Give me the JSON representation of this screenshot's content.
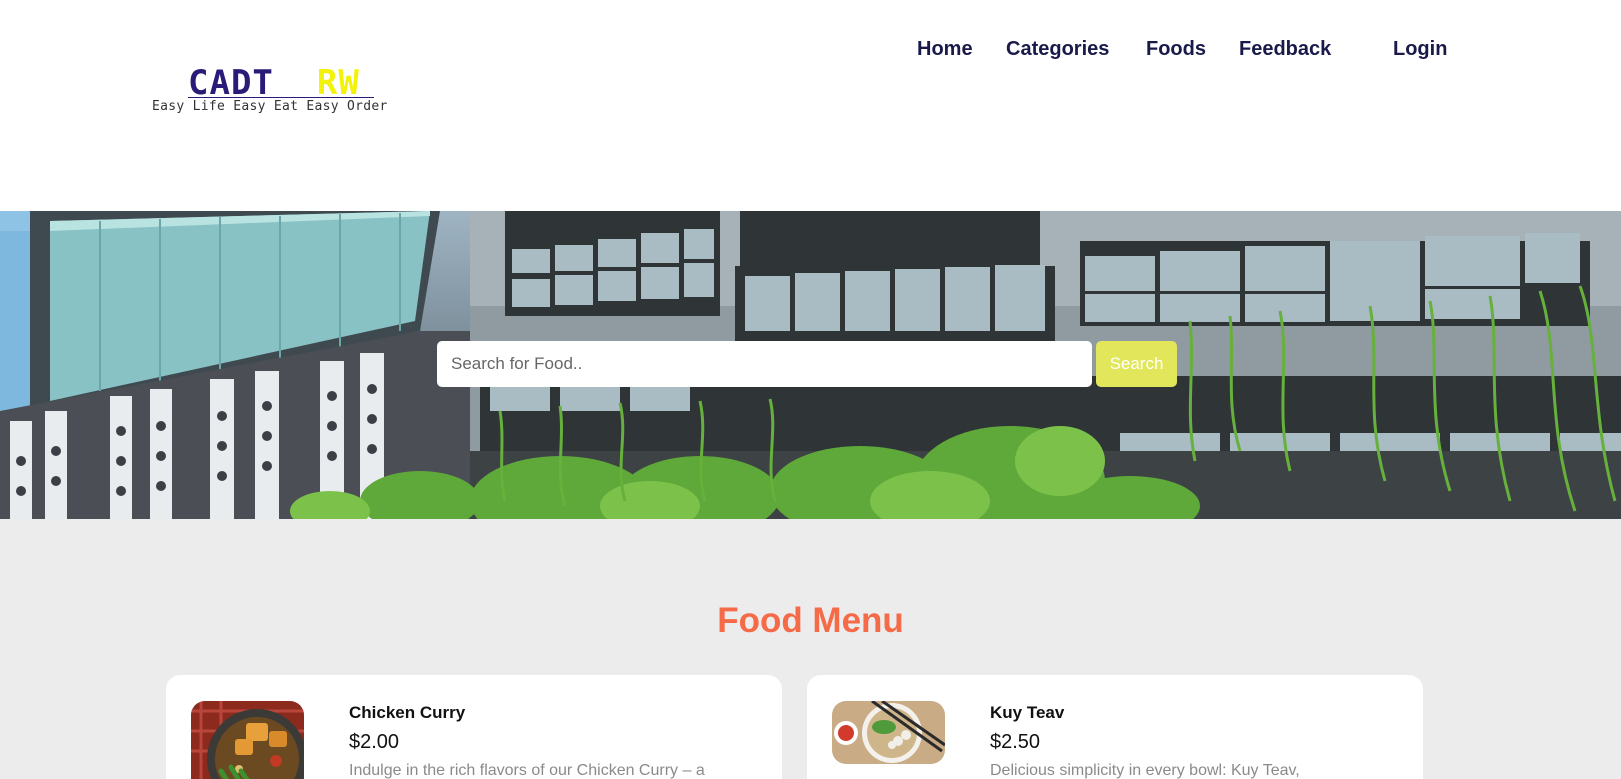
{
  "brand": {
    "logo_part1": "CADT",
    "logo_part2": "RW",
    "tagline": "Easy Life Easy Eat Easy Order"
  },
  "nav": {
    "items": [
      {
        "label": "Home"
      },
      {
        "label": "Categories"
      },
      {
        "label": "Foods"
      },
      {
        "label": "Feedback"
      },
      {
        "label": "Login"
      }
    ]
  },
  "search": {
    "placeholder": "Search for Food..",
    "button_label": "Search"
  },
  "menu": {
    "title": "Food Menu",
    "items": [
      {
        "name": "Chicken Curry",
        "price": "$2.00",
        "description": "Indulge in the rich flavors of our Chicken Curry – a",
        "image_icon": "chicken-curry-photo"
      },
      {
        "name": "Kuy Teav",
        "price": "$2.50",
        "description": "Delicious simplicity in every bowl: Kuy Teav,",
        "image_icon": "kuy-teav-photo"
      }
    ]
  },
  "colors": {
    "nav_text": "#1a1a4a",
    "logo_primary": "#2b1a78",
    "logo_accent": "#f2f20a",
    "search_button": "#e1e65a",
    "menu_title": "#f56a47",
    "menu_background": "#ececec"
  }
}
